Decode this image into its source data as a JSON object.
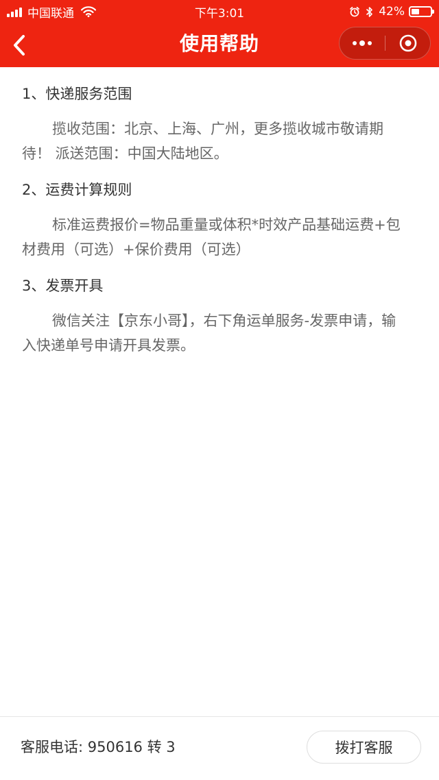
{
  "status_bar": {
    "carrier": "中国联通",
    "time": "下午3:01",
    "battery_percent": "42%",
    "battery_level": 0.42,
    "icons": [
      "signal-icon",
      "wifi-icon",
      "alarm-icon",
      "bluetooth-icon",
      "battery-icon"
    ]
  },
  "nav": {
    "title": "使用帮助",
    "back_icon": "back-arrow-icon",
    "more_icon": "more-dots-icon",
    "close_icon": "close-target-icon",
    "bar_color": "#ee2411"
  },
  "sections": [
    {
      "title": "1、快递服务范围",
      "body": "揽收范围：北京、上海、广州，更多揽收城市敬请期待！ 派送范围：中国大陆地区。"
    },
    {
      "title": "2、运费计算规则",
      "body": "标准运费报价=物品重量或体积*时效产品基础运费+包材费用（可选）+保价费用（可选）"
    },
    {
      "title": "3、发票开具",
      "body": "微信关注【京东小哥】，右下角运单服务-发票申请，输入快递单号申请开具发票。"
    }
  ],
  "footer": {
    "hotline": "客服电话: 950616 转 3",
    "call_button": "拨打客服"
  }
}
